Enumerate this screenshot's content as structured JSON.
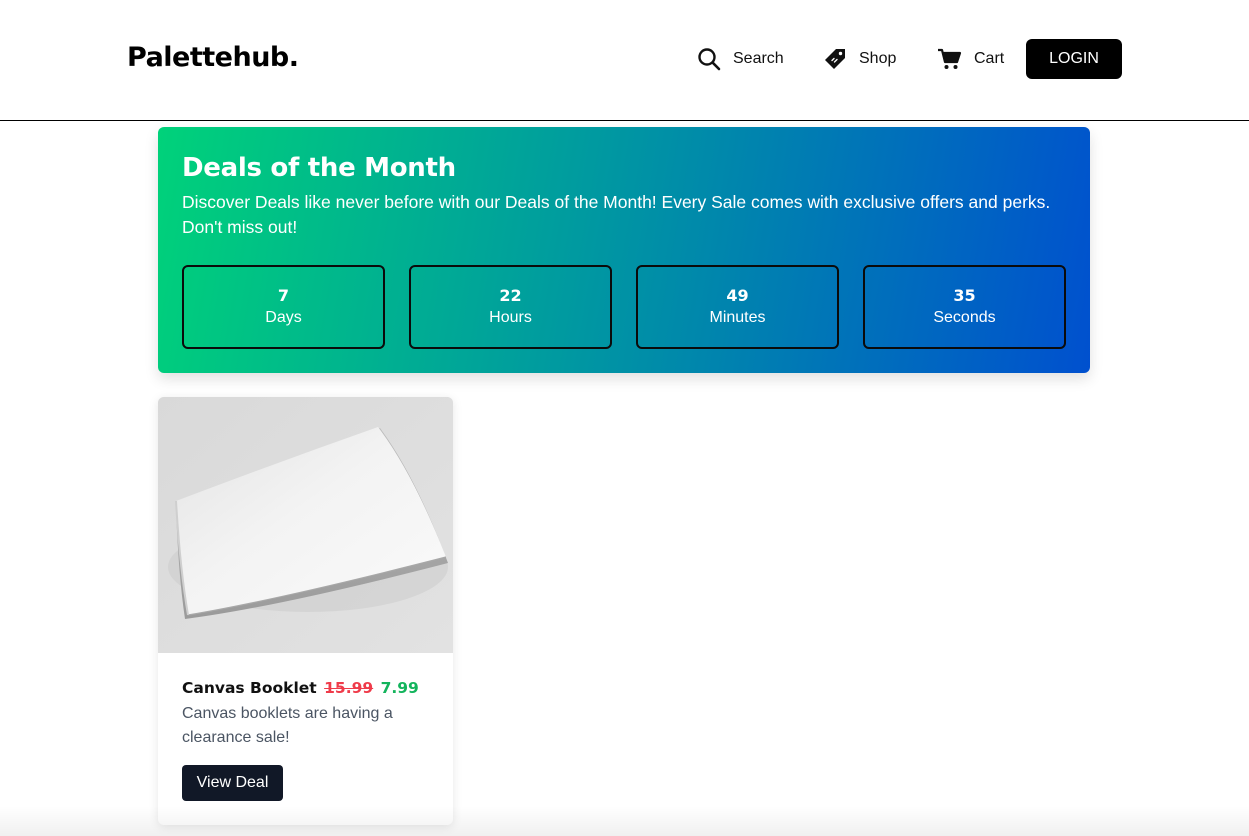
{
  "header": {
    "logo": "Palettehub.",
    "nav": {
      "search": {
        "label": "Search",
        "icon": "search-icon"
      },
      "shop": {
        "label": "Shop",
        "icon": "tag-icon"
      },
      "cart": {
        "label": "Cart",
        "icon": "cart-icon"
      }
    },
    "login_label": "LOGIN"
  },
  "banner": {
    "title": "Deals of the Month",
    "description": "Discover Deals like never before with our Deals of the Month! Every Sale comes with exclusive offers and perks. Don't miss out!",
    "countdown": [
      {
        "value": "7",
        "unit": "Days"
      },
      {
        "value": "22",
        "unit": "Hours"
      },
      {
        "value": "49",
        "unit": "Minutes"
      },
      {
        "value": "35",
        "unit": "Seconds"
      }
    ],
    "gradient_colors": [
      "#00d27a",
      "#0050cf"
    ]
  },
  "deals": [
    {
      "name": "Canvas Booklet",
      "old_price": "15.99",
      "new_price": "7.99",
      "description": "Canvas booklets are having a clearance sale!",
      "button_label": "View Deal",
      "image": "booklet-image"
    }
  ],
  "colors": {
    "old_price": "#ef3b4a",
    "new_price": "#13b45c",
    "button": "#111827"
  }
}
